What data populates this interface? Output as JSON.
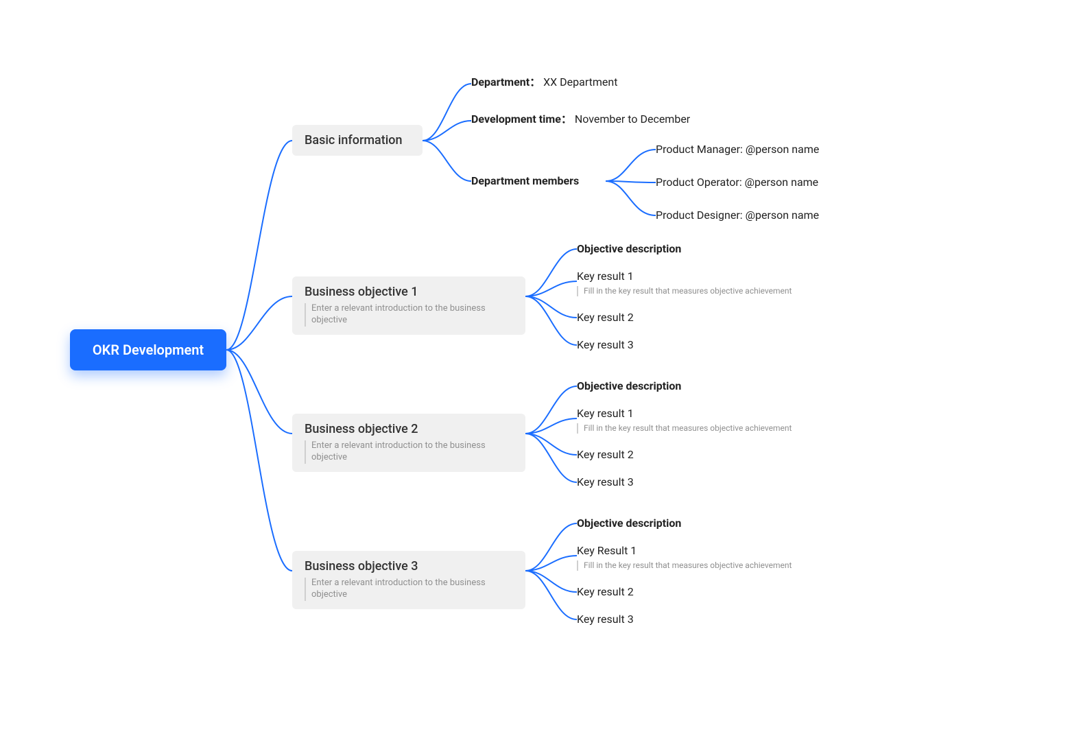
{
  "root": "OKR Development",
  "basic": {
    "title": "Basic information",
    "department": {
      "label": "Department",
      "value": "XX Department"
    },
    "devtime": {
      "label": "Development time",
      "value": "November to December"
    },
    "members": {
      "label": "Department members",
      "items": [
        "Product Manager: @person name",
        "Product Operator: @person name",
        "Product Designer: @person name"
      ]
    }
  },
  "objectives": [
    {
      "title": "Business objective 1",
      "note": "Enter a relevant introduction to the business objective",
      "desc": "Objective description",
      "keys": [
        {
          "label": "Key result 1",
          "hint": "Fill in the key result that measures objective achievement"
        },
        {
          "label": "Key result 2"
        },
        {
          "label": "Key result 3"
        }
      ]
    },
    {
      "title": "Business objective 2",
      "note": "Enter a relevant introduction to the business objective",
      "desc": "Objective description",
      "keys": [
        {
          "label": "Key result 1",
          "hint": "Fill in the key result that measures objective achievement"
        },
        {
          "label": "Key result 2"
        },
        {
          "label": "Key result 3"
        }
      ]
    },
    {
      "title": "Business objective 3",
      "note": "Enter a relevant introduction to the business objective",
      "desc": "Objective description",
      "keys": [
        {
          "label": "Key Result 1",
          "hint": "Fill in the key result that measures objective achievement"
        },
        {
          "label": "Key result 2"
        },
        {
          "label": "Key result 3"
        }
      ]
    }
  ]
}
